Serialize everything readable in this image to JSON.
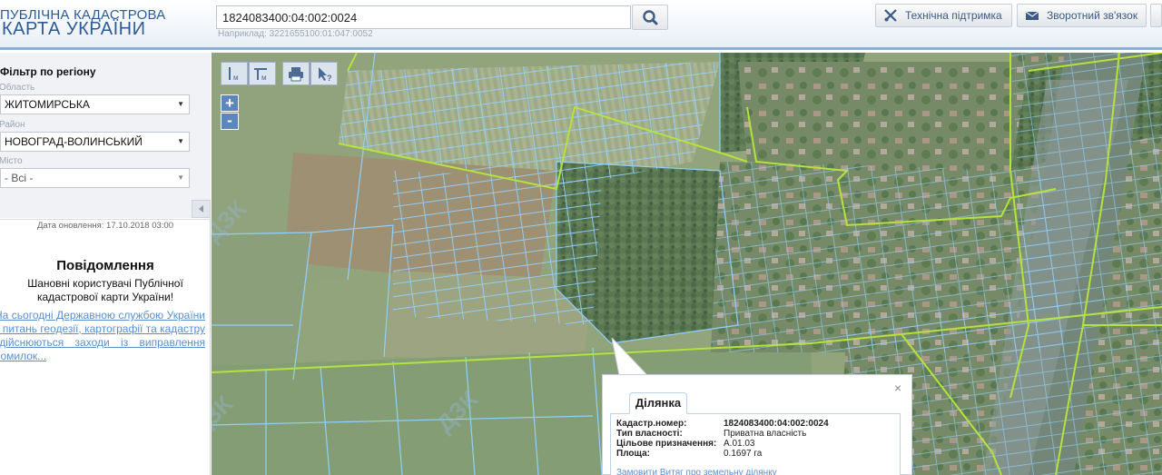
{
  "header": {
    "logo_line1": "ПУБЛІЧНА КАДАСТРОВА",
    "logo_line2": "КАРТА УКРАЇНИ",
    "search_value": "1824083400:04:002:0024",
    "search_hint": "Наприклад: 3221655100:01:047:0052",
    "support_label": "Технічна підтримка",
    "feedback_label": "Зворотний зв'язок"
  },
  "sidebar": {
    "filter_title": "Фільтр по регіону",
    "region_label": "Область",
    "region_value": "ЖИТОМИРСЬКА",
    "district_label": "Район",
    "district_value": "НОВОГРАД-ВОЛИНСЬКИЙ",
    "city_label": "Місто",
    "city_value": "- Всі -",
    "update_date": "Дата оновлення: 17.10.2018 03:00",
    "notice_title": "Повідомлення",
    "notice_greeting": "Шановні користувачі Публічної кадастрової карти України!",
    "notice_link": "На сьогодні Державною службою України з питань геодезії, картографії та кадастру здійснюються заходи із виправлення помилок..."
  },
  "map": {
    "watermarks": [
      "ДЗК",
      "ДЗК",
      "ДЗК"
    ],
    "zoom_in": "+",
    "zoom_out": "-"
  },
  "popup": {
    "tab_label": "Ділянка",
    "fields": [
      {
        "key": "Кадастр.номер:",
        "value": "1824083400:04:002:0024"
      },
      {
        "key": "Тип власності:",
        "value": "Приватна власність"
      },
      {
        "key": "Цільове призначення:",
        "value": "A.01.03"
      },
      {
        "key": "Площа:",
        "value": "0.1697 га"
      }
    ],
    "link": "Замовити Витяг про земельну ділянку",
    "close": "×"
  },
  "colors": {
    "brand": "#2c5c97",
    "parcel_stroke": "#7ec3f2",
    "boundary": "#b5e23c",
    "link": "#5a8fcf"
  },
  "icons": [
    "search-icon",
    "wrench-icon",
    "envelope-icon",
    "ruler-line-icon",
    "ruler-area-icon",
    "printer-icon",
    "cursor-query-icon",
    "chevron-left-icon",
    "close-icon"
  ]
}
